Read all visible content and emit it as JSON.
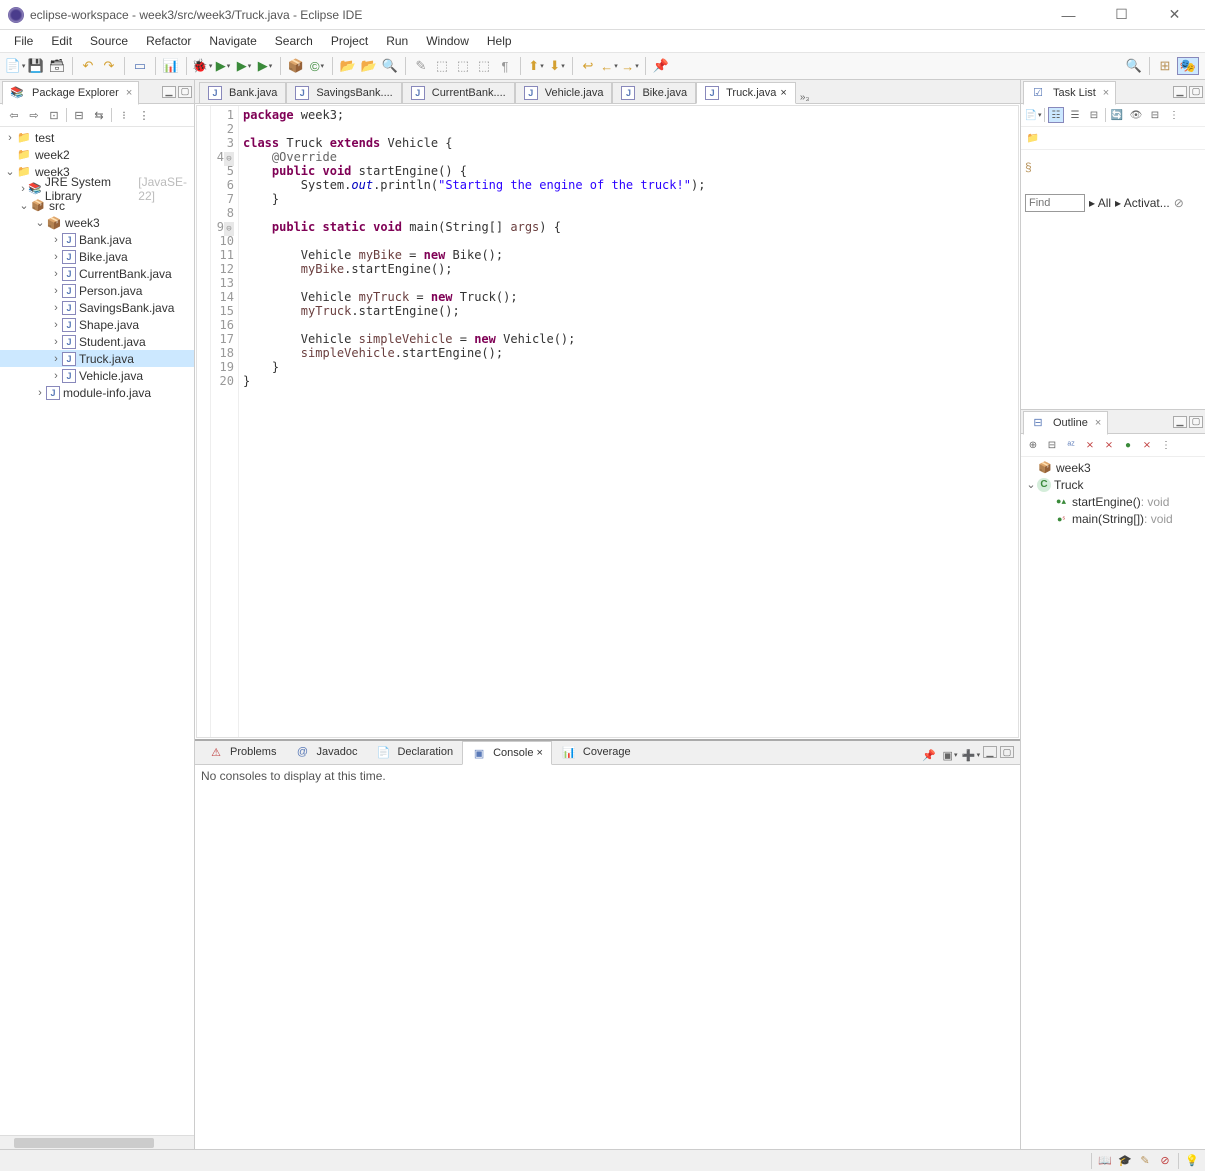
{
  "titlebar": {
    "title": "eclipse-workspace - week3/src/week3/Truck.java - Eclipse IDE"
  },
  "menubar": [
    "File",
    "Edit",
    "Source",
    "Refactor",
    "Navigate",
    "Search",
    "Project",
    "Run",
    "Window",
    "Help"
  ],
  "package_explorer": {
    "title": "Package Explorer",
    "tree": {
      "test": "test",
      "week2": "week2",
      "week3": {
        "label": "week3",
        "jre": "JRE System Library",
        "jre_suffix": "[JavaSE-22]",
        "src": "src",
        "pkg": "week3",
        "files": [
          "Bank.java",
          "Bike.java",
          "CurrentBank.java",
          "Person.java",
          "SavingsBank.java",
          "Shape.java",
          "Student.java",
          "Truck.java",
          "Vehicle.java"
        ],
        "module": "module-info.java"
      }
    }
  },
  "editor": {
    "tabs": [
      "Bank.java",
      "SavingsBank....",
      "CurrentBank....",
      "Vehicle.java",
      "Bike.java",
      "Truck.java"
    ],
    "overflow": "»₃",
    "active_tab": "Truck.java",
    "code_lines": [
      {
        "n": 1,
        "html": "<span class=\"kw\">package</span> week3;"
      },
      {
        "n": 2,
        "html": ""
      },
      {
        "n": 3,
        "html": "<span class=\"kw\">class</span> Truck <span class=\"kw\">extends</span> Vehicle {"
      },
      {
        "n": 4,
        "mark": "⊖",
        "html": "    <span class=\"ann\">@Override</span>"
      },
      {
        "n": 5,
        "html": "    <span class=\"kw\">public</span> <span class=\"kw\">void</span> startEngine() {"
      },
      {
        "n": 6,
        "html": "        System.<span class=\"fld\">out</span>.println(<span class=\"str\">\"Starting the engine of the truck!\"</span>);"
      },
      {
        "n": 7,
        "html": "    }"
      },
      {
        "n": 8,
        "html": ""
      },
      {
        "n": 9,
        "mark": "⊖",
        "html": "    <span class=\"kw\">public</span> <span class=\"kw\">static</span> <span class=\"kw\">void</span> main(String[] <span class=\"var\">args</span>) {"
      },
      {
        "n": 10,
        "html": ""
      },
      {
        "n": 11,
        "html": "        Vehicle <span class=\"var\">myBike</span> = <span class=\"kw\">new</span> Bike();"
      },
      {
        "n": 12,
        "html": "        <span class=\"var\">myBike</span>.startEngine();"
      },
      {
        "n": 13,
        "html": ""
      },
      {
        "n": 14,
        "html": "        Vehicle <span class=\"var\">myTruck</span> = <span class=\"kw\">new</span> Truck();"
      },
      {
        "n": 15,
        "html": "        <span class=\"var\">myTruck</span>.startEngine();"
      },
      {
        "n": 16,
        "html": ""
      },
      {
        "n": 17,
        "html": "        Vehicle <span class=\"var\">simpleVehicle</span> = <span class=\"kw\">new</span> Vehicle();"
      },
      {
        "n": 18,
        "html": "        <span class=\"var\">simpleVehicle</span>.startEngine();"
      },
      {
        "n": 19,
        "html": "    }"
      },
      {
        "n": 20,
        "hl": true,
        "html": "}"
      }
    ]
  },
  "tasklist": {
    "title": "Task List",
    "find_placeholder": "Find",
    "all": "All",
    "activate": "Activat..."
  },
  "outline": {
    "title": "Outline",
    "pkg": "week3",
    "class": "Truck",
    "m1": "startEngine()",
    "m1_ret": " : void",
    "m2": "main(String[])",
    "m2_ret": " : void"
  },
  "bottom": {
    "tabs": [
      "Problems",
      "Javadoc",
      "Declaration",
      "Console",
      "Coverage"
    ],
    "active": "Console",
    "console_msg": "No consoles to display at this time."
  }
}
